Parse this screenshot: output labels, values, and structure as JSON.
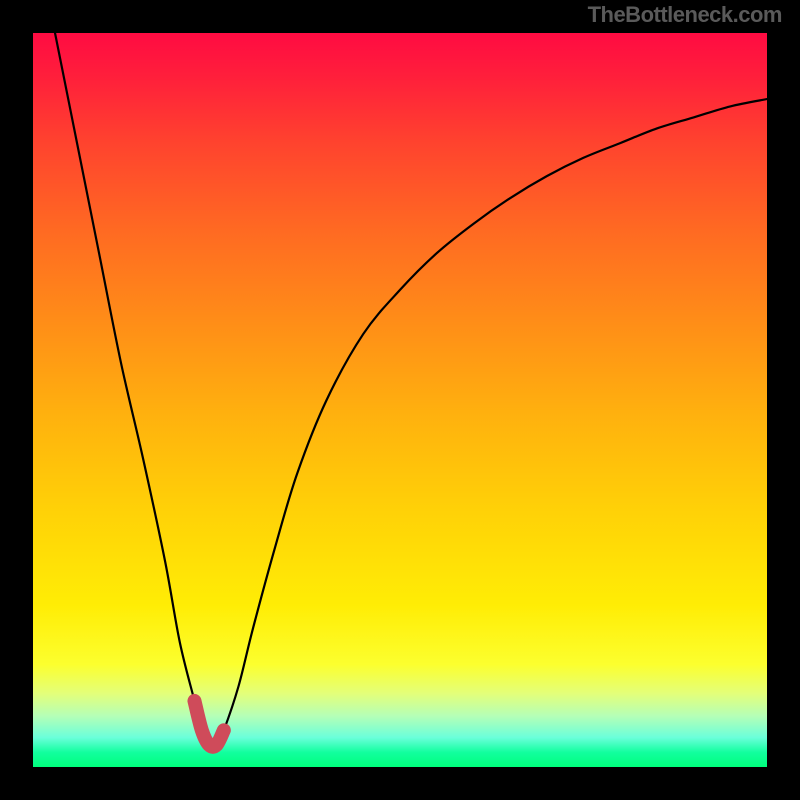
{
  "watermark": "TheBottleneck.com",
  "chart_data": {
    "type": "line",
    "title": "",
    "xlabel": "",
    "ylabel": "",
    "xlim": [
      0,
      100
    ],
    "ylim": [
      0,
      100
    ],
    "series": [
      {
        "name": "bottleneck-curve",
        "x": [
          3,
          6,
          9,
          12,
          15,
          18,
          20,
          22,
          23,
          24,
          25,
          26,
          28,
          30,
          33,
          36,
          40,
          45,
          50,
          55,
          60,
          65,
          70,
          75,
          80,
          85,
          90,
          95,
          100
        ],
        "values": [
          100,
          85,
          70,
          55,
          42,
          28,
          17,
          9,
          5,
          3,
          3,
          5,
          11,
          19,
          30,
          40,
          50,
          59,
          65,
          70,
          74,
          77.5,
          80.5,
          83,
          85,
          87,
          88.5,
          90,
          91
        ]
      }
    ],
    "annotations": [
      {
        "name": "highlighted-minimum",
        "x_range": [
          22,
          27
        ],
        "y_approx": 3
      }
    ],
    "background_gradient": {
      "direction": "vertical",
      "stops": [
        {
          "pos": 0,
          "color": "#ff0b42"
        },
        {
          "pos": 50,
          "color": "#ffb10e"
        },
        {
          "pos": 85,
          "color": "#fcff2e"
        },
        {
          "pos": 100,
          "color": "#00ff7d"
        }
      ]
    }
  }
}
